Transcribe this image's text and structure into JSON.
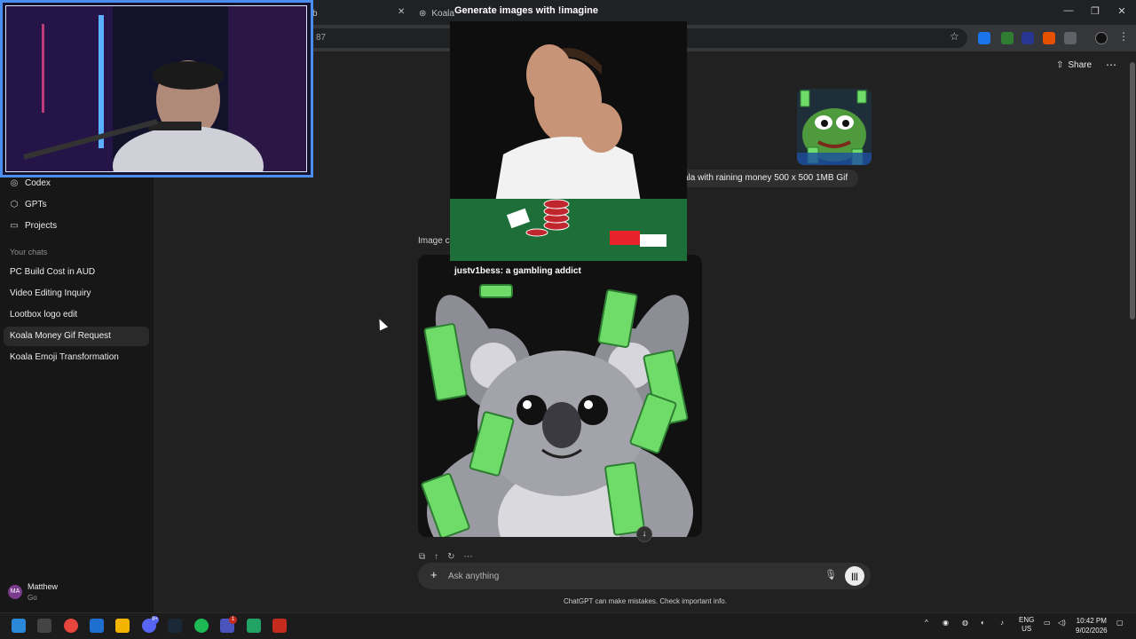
{
  "browser": {
    "tab_left_title": "b",
    "tab_active_title": "Koala",
    "address_partial": "87"
  },
  "header": {
    "share_label": "Share"
  },
  "sidebar": {
    "items": [
      {
        "label": "Codex",
        "icon": "codex-icon"
      },
      {
        "label": "GPTs",
        "icon": "gpts-icon"
      },
      {
        "label": "Projects",
        "icon": "folder-icon"
      }
    ],
    "section_label": "Your chats",
    "chats": [
      {
        "label": "PC Build Cost in AUD"
      },
      {
        "label": "Video Editing Inquiry"
      },
      {
        "label": "Lootbox logo edit"
      },
      {
        "label": "Koala Money Gif Request",
        "active": true
      },
      {
        "label": "Koala Emoji Transformation"
      }
    ],
    "user": {
      "initials": "MA",
      "name": "Matthew",
      "plan": "Go"
    }
  },
  "conversation": {
    "user_message": "ala with raining money  500 x 500 1MB Gif",
    "image_caption": "Image c"
  },
  "composer": {
    "placeholder": "Ask anything",
    "disclaimer": "ChatGPT can make mistakes. Check important info."
  },
  "overlay": {
    "alert_title": "Generate images with !imagine",
    "alert_subtitle": "justv1bess: a gambling addict"
  },
  "taskbar": {
    "discord_badge": "9+",
    "teams_badge": "1",
    "lang_line1": "ENG",
    "lang_line2": "US",
    "time": "10:42 PM",
    "date": "9/02/2026"
  },
  "colors": {
    "accent_blue": "#4b8df0",
    "money_green": "#6fdc6a",
    "page_bg": "#212121",
    "sidebar_bg": "#171717"
  }
}
